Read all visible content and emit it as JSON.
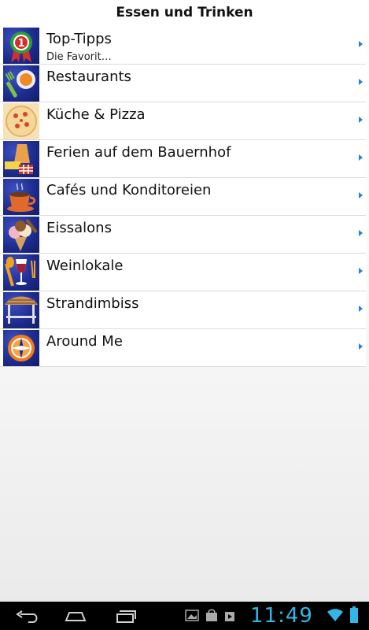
{
  "app_title": "Essen und Trinken",
  "items": [
    {
      "label": "Top-Tipps",
      "sub": "Die Favorit…",
      "icon": "ribbon-number-one-icon"
    },
    {
      "label": "Restaurants",
      "icon": "fork-plate-icon"
    },
    {
      "label": "Küche & Pizza",
      "icon": "pizza-icon"
    },
    {
      "label": "Ferien auf dem Bauernhof",
      "icon": "farm-food-icon"
    },
    {
      "label": "Cafés und Konditoreien",
      "icon": "coffee-cup-icon"
    },
    {
      "label": "Eissalons",
      "icon": "ice-cream-icon"
    },
    {
      "label": "Weinlokale",
      "icon": "wine-glass-icon"
    },
    {
      "label": "Strandimbiss",
      "icon": "beach-hut-icon"
    },
    {
      "label": "Around Me",
      "icon": "compass-icon"
    }
  ],
  "system_bar": {
    "time": "11:49",
    "nav_icons": [
      "back-icon",
      "home-icon",
      "recent-apps-icon"
    ],
    "status_icons": [
      "gallery-icon",
      "shopping-bag-icon",
      "play-store-icon",
      "wifi-icon",
      "battery-icon"
    ],
    "accent_color": "#33b5e5"
  }
}
